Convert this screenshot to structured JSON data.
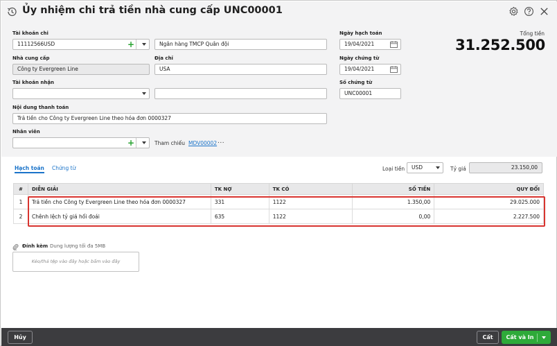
{
  "header": {
    "title": "Ủy nhiệm chi trả tiền nhà cung cấp UNC00001",
    "history_icon": "history-icon",
    "settings_icon": "gear-icon",
    "help_icon": "help-icon",
    "close_icon": "close-icon"
  },
  "form": {
    "account_label": "Tài khoản chi",
    "account_value": "11112566USD",
    "bank_value": "Ngân hàng TMCP Quân đội",
    "supplier_label": "Nhà cung cấp",
    "supplier_value": "Công ty Evergreen Line",
    "address_label": "Địa chỉ",
    "address_value": "USA",
    "receive_account_label": "Tài khoản nhận",
    "receive_account_value": "",
    "receive_bank_value": "",
    "content_label": "Nội dung thanh toán",
    "content_value": "Trả tiền cho Công ty Evergreen Line theo hóa đơn 0000327",
    "employee_label": "Nhân viên",
    "employee_value": "",
    "reference_label": "Tham chiếu",
    "reference_link": "MDV00002",
    "reference_more": "...",
    "posting_date_label": "Ngày hạch toán",
    "posting_date_value": "19/04/2021",
    "voucher_date_label": "Ngày chứng từ",
    "voucher_date_value": "19/04/2021",
    "voucher_no_label": "Số chứng từ",
    "voucher_no_value": "UNC00001",
    "total_label": "Tổng tiền",
    "total_value": "31.252.500"
  },
  "tabs": [
    {
      "label": "Hạch toán",
      "active": true
    },
    {
      "label": "Chứng từ",
      "active": false
    }
  ],
  "currency": {
    "label": "Loại tiền",
    "value": "USD",
    "rate_label": "Tỷ giá",
    "rate_value": "23.150,00"
  },
  "table": {
    "columns": [
      "#",
      "DIỄN GIẢI",
      "TK NỢ",
      "TK CÓ",
      "SỐ TIỀN",
      "QUY ĐỔI"
    ],
    "rows": [
      {
        "no": "1",
        "desc": "Trả tiền cho Công ty Evergreen Line theo hóa đơn 0000327",
        "debit": "331",
        "credit": "1122",
        "amount": "1.350,00",
        "converted": "29.025.000"
      },
      {
        "no": "2",
        "desc": "Chênh lệch tỷ giá hối đoái",
        "debit": "635",
        "credit": "1122",
        "amount": "0,00",
        "converted": "2.227.500"
      }
    ]
  },
  "attachment": {
    "label": "Đính kèm",
    "hint": "Dung lượng tối đa 5MB",
    "dropzone": "Kéo/thả tệp vào đây hoặc bấm vào đây"
  },
  "footer": {
    "cancel": "Hủy",
    "save": "Cất",
    "save_print": "Cất và In"
  },
  "colors": {
    "accent": "#1a73c9",
    "primary_button": "#2eaa39",
    "footer_bg": "#3c3c3f",
    "highlight": "#d8342f"
  }
}
